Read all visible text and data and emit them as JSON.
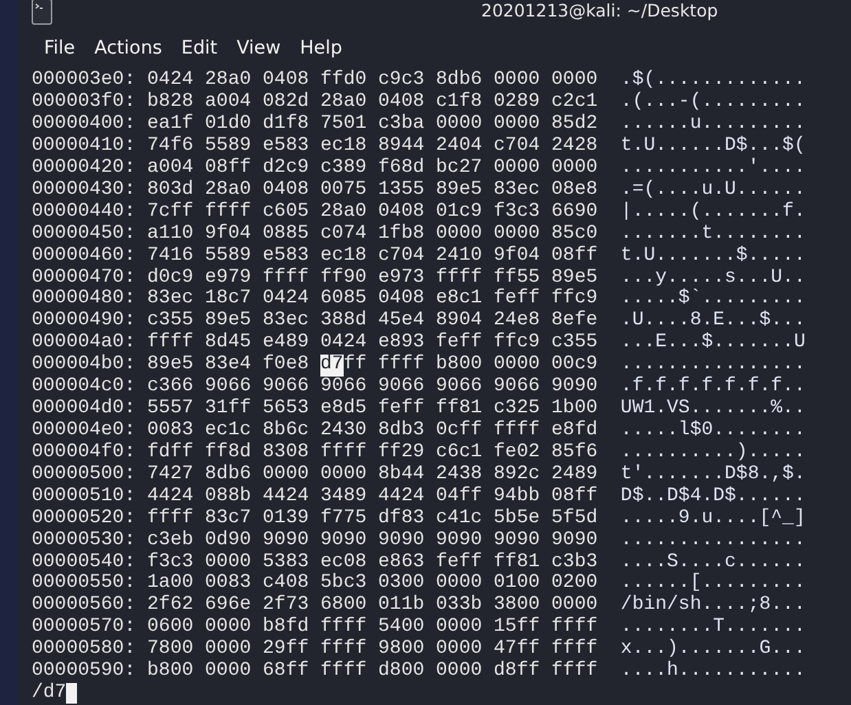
{
  "window": {
    "title": "20201213@kali: ~/Desktop"
  },
  "menu": [
    "File",
    "Actions",
    "Edit",
    "View",
    "Help"
  ],
  "rows": [
    {
      "offset": "000003e0:",
      "groups": [
        "0424",
        "28a0",
        "0408",
        "ffd0",
        "c9c3",
        "8db6",
        "0000",
        "0000"
      ],
      "ascii": ".$(............."
    },
    {
      "offset": "000003f0:",
      "groups": [
        "b828",
        "a004",
        "082d",
        "28a0",
        "0408",
        "c1f8",
        "0289",
        "c2c1"
      ],
      "ascii": ".(...-(........."
    },
    {
      "offset": "00000400:",
      "groups": [
        "ea1f",
        "01d0",
        "d1f8",
        "7501",
        "c3ba",
        "0000",
        "0000",
        "85d2"
      ],
      "ascii": "......u........."
    },
    {
      "offset": "00000410:",
      "groups": [
        "74f6",
        "5589",
        "e583",
        "ec18",
        "8944",
        "2404",
        "c704",
        "2428"
      ],
      "ascii": "t.U......D$...$("
    },
    {
      "offset": "00000420:",
      "groups": [
        "a004",
        "08ff",
        "d2c9",
        "c389",
        "f68d",
        "bc27",
        "0000",
        "0000"
      ],
      "ascii": "...........'...."
    },
    {
      "offset": "00000430:",
      "groups": [
        "803d",
        "28a0",
        "0408",
        "0075",
        "1355",
        "89e5",
        "83ec",
        "08e8"
      ],
      "ascii": ".=(....u.U......"
    },
    {
      "offset": "00000440:",
      "groups": [
        "7cff",
        "ffff",
        "c605",
        "28a0",
        "0408",
        "01c9",
        "f3c3",
        "6690"
      ],
      "ascii": "|.....(.......f."
    },
    {
      "offset": "00000450:",
      "groups": [
        "a110",
        "9f04",
        "0885",
        "c074",
        "1fb8",
        "0000",
        "0000",
        "85c0"
      ],
      "ascii": ".......t........"
    },
    {
      "offset": "00000460:",
      "groups": [
        "7416",
        "5589",
        "e583",
        "ec18",
        "c704",
        "2410",
        "9f04",
        "08ff"
      ],
      "ascii": "t.U.......$....."
    },
    {
      "offset": "00000470:",
      "groups": [
        "d0c9",
        "e979",
        "ffff",
        "ff90",
        "e973",
        "ffff",
        "ff55",
        "89e5"
      ],
      "ascii": "...y.....s...U.."
    },
    {
      "offset": "00000480:",
      "groups": [
        "83ec",
        "18c7",
        "0424",
        "6085",
        "0408",
        "e8c1",
        "feff",
        "ffc9"
      ],
      "ascii": ".....$`........."
    },
    {
      "offset": "00000490:",
      "groups": [
        "c355",
        "89e5",
        "83ec",
        "388d",
        "45e4",
        "8904",
        "24e8",
        "8efe"
      ],
      "ascii": ".U....8.E...$..."
    },
    {
      "offset": "000004a0:",
      "groups": [
        "ffff",
        "8d45",
        "e489",
        "0424",
        "e893",
        "feff",
        "ffc9",
        "c355"
      ],
      "ascii": "...E...$.......U"
    },
    {
      "offset": "000004b0:",
      "groups": [
        "89e5",
        "83e4",
        "f0e8",
        [
          {
            "text": "d7",
            "selected": true
          },
          {
            "text": "ff",
            "selected": false
          }
        ],
        "ffff",
        "b800",
        "0000",
        "00c9"
      ],
      "ascii": "................"
    },
    {
      "offset": "000004c0:",
      "groups": [
        "c366",
        "9066",
        "9066",
        "9066",
        "9066",
        "9066",
        "9066",
        "9090"
      ],
      "ascii": ".f.f.f.f.f.f.f.."
    },
    {
      "offset": "000004d0:",
      "groups": [
        "5557",
        "31ff",
        "5653",
        "e8d5",
        "feff",
        "ff81",
        "c325",
        "1b00"
      ],
      "ascii": "UW1.VS.......%.."
    },
    {
      "offset": "000004e0:",
      "groups": [
        "0083",
        "ec1c",
        "8b6c",
        "2430",
        "8db3",
        "0cff",
        "ffff",
        "e8fd"
      ],
      "ascii": ".....l$0........"
    },
    {
      "offset": "000004f0:",
      "groups": [
        "fdff",
        "ff8d",
        "8308",
        "ffff",
        "ff29",
        "c6c1",
        "fe02",
        "85f6"
      ],
      "ascii": "..........)....."
    },
    {
      "offset": "00000500:",
      "groups": [
        "7427",
        "8db6",
        "0000",
        "0000",
        "8b44",
        "2438",
        "892c",
        "2489"
      ],
      "ascii": "t'.......D$8.,$."
    },
    {
      "offset": "00000510:",
      "groups": [
        "4424",
        "088b",
        "4424",
        "3489",
        "4424",
        "04ff",
        "94bb",
        "08ff"
      ],
      "ascii": "D$..D$4.D$......"
    },
    {
      "offset": "00000520:",
      "groups": [
        "ffff",
        "83c7",
        "0139",
        "f775",
        "df83",
        "c41c",
        "5b5e",
        "5f5d"
      ],
      "ascii": ".....9.u....[^_]"
    },
    {
      "offset": "00000530:",
      "groups": [
        "c3eb",
        "0d90",
        "9090",
        "9090",
        "9090",
        "9090",
        "9090",
        "9090"
      ],
      "ascii": "................"
    },
    {
      "offset": "00000540:",
      "groups": [
        "f3c3",
        "0000",
        "5383",
        "ec08",
        "e863",
        "feff",
        "ff81",
        "c3b3"
      ],
      "ascii": "....S....c......"
    },
    {
      "offset": "00000550:",
      "groups": [
        "1a00",
        "0083",
        "c408",
        "5bc3",
        "0300",
        "0000",
        "0100",
        "0200"
      ],
      "ascii": "......[........."
    },
    {
      "offset": "00000560:",
      "groups": [
        "2f62",
        "696e",
        "2f73",
        "6800",
        "011b",
        "033b",
        "3800",
        "0000"
      ],
      "ascii": "/bin/sh....;8..."
    },
    {
      "offset": "00000570:",
      "groups": [
        "0600",
        "0000",
        "b8fd",
        "ffff",
        "5400",
        "0000",
        "15ff",
        "ffff"
      ],
      "ascii": "........T......."
    },
    {
      "offset": "00000580:",
      "groups": [
        "7800",
        "0000",
        "29ff",
        "ffff",
        "9800",
        "0000",
        "47ff",
        "ffff"
      ],
      "ascii": "x...).......G..."
    },
    {
      "offset": "00000590:",
      "groups": [
        "b800",
        "0000",
        "68ff",
        "ffff",
        "d800",
        "0000",
        "d8ff",
        "ffff"
      ],
      "ascii": "....h..........."
    }
  ],
  "prompt": "/d7"
}
